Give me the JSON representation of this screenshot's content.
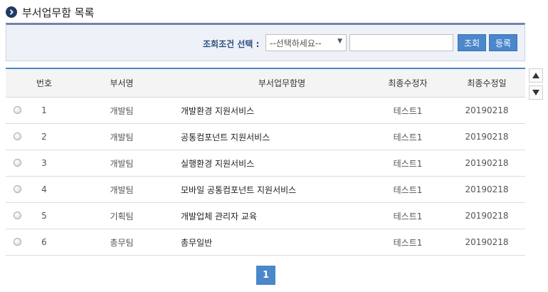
{
  "title": "부서업무함 목록",
  "search": {
    "label": "조회조건 선택 :",
    "select_value": "--선택하세요--",
    "input_value": "",
    "search_button": "조회",
    "register_button": "등록"
  },
  "table": {
    "headers": {
      "no": "번호",
      "dept": "부서명",
      "task": "부서업무함명",
      "modifier": "최종수정자",
      "date": "최종수정일"
    },
    "rows": [
      {
        "no": "1",
        "dept": "개발팀",
        "task": "개발환경 지원서비스",
        "modifier": "테스트1",
        "date": "20190218"
      },
      {
        "no": "2",
        "dept": "개발팀",
        "task": "공통컴포넌트 지원서비스",
        "modifier": "테스트1",
        "date": "20190218"
      },
      {
        "no": "3",
        "dept": "개발팀",
        "task": "실행환경 지원서비스",
        "modifier": "테스트1",
        "date": "20190218"
      },
      {
        "no": "4",
        "dept": "개발팀",
        "task": "모바일 공통컴포넌트 지원서비스",
        "modifier": "테스트1",
        "date": "20190218"
      },
      {
        "no": "5",
        "dept": "기획팀",
        "task": "개발업체 관리자 교육",
        "modifier": "테스트1",
        "date": "20190218"
      },
      {
        "no": "6",
        "dept": "총무팀",
        "task": "총무일반",
        "modifier": "테스트1",
        "date": "20190218"
      }
    ]
  },
  "pagination": {
    "current": "1"
  },
  "icons": {
    "title": "chevron-right-circle-icon",
    "select": "triangle-down-icon",
    "scroll_up": "triangle-up-icon",
    "scroll_down": "triangle-down-icon"
  },
  "colors": {
    "accent": "#4a87cb",
    "title_icon": "#1f3b63",
    "search_bg": "#eef2f8",
    "search_label": "#2c4e7d"
  }
}
